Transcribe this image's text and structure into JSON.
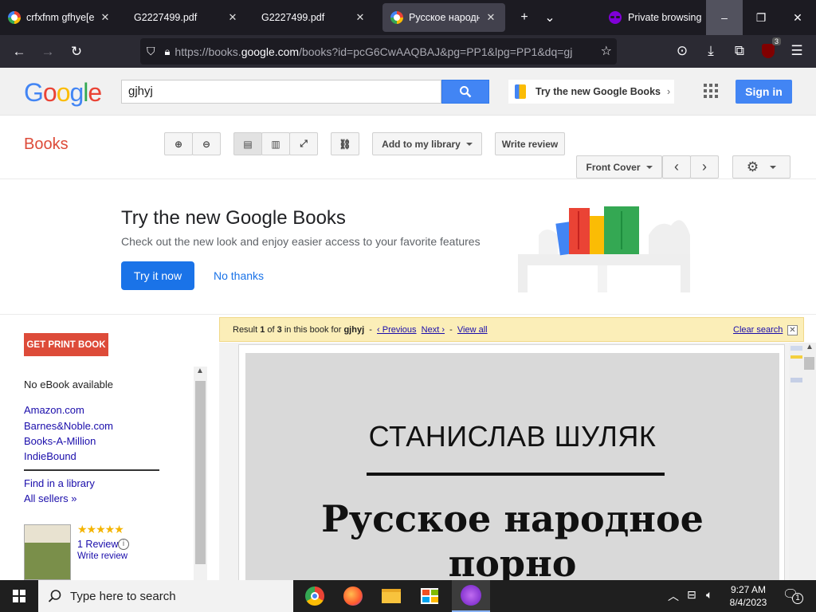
{
  "browser": {
    "tabs": [
      {
        "title": "crfxfnm gfhye[e - (",
        "active": false,
        "favicon": "google-icon"
      },
      {
        "title": "G2227499.pdf",
        "active": false,
        "favicon": "pdf-icon"
      },
      {
        "title": "G2227499.pdf",
        "active": false,
        "favicon": "pdf-icon"
      },
      {
        "title": "Русское народное",
        "active": true,
        "favicon": "google-icon"
      }
    ],
    "private_label": "Private browsing",
    "url_prefix": "https://books.",
    "url_domain": "google.com",
    "url_rest": "/books?id=pcG6CwAAQBAJ&pg=PP1&lpg=PP1&dq=gj",
    "extension_badge": "3"
  },
  "header": {
    "logo": "Google",
    "search_value": "gjhyj",
    "try_new_label": "Try the new Google Books",
    "signin_label": "Sign in"
  },
  "toolbar": {
    "books_label": "Books",
    "add_library_label": "Add to my library",
    "write_review_label": "Write review",
    "front_cover_label": "Front Cover"
  },
  "promo": {
    "title": "Try the new Google Books",
    "subtitle": "Check out the new look and enjoy easier access to your favorite features",
    "try_now": "Try it now",
    "no_thanks": "No thanks"
  },
  "sidebar": {
    "get_print": "GET PRINT BOOK",
    "no_ebook": "No eBook available",
    "sellers": [
      "Amazon.com",
      "Barnes&Noble.com",
      "Books-A-Million",
      "IndieBound"
    ],
    "find_library": "Find in a library",
    "all_sellers": "All sellers »",
    "stars": "★★★★★",
    "review_count": "1 Review",
    "write_review": "Write review"
  },
  "result_bar": {
    "prefix": "Result ",
    "current": "1",
    "of": " of ",
    "total": "3",
    "mid": " in this book for ",
    "query": "gjhyj",
    "previous": "‹ Previous",
    "next": "Next ›",
    "view_all": "View all",
    "clear": "Clear search"
  },
  "book_page": {
    "author": "СТАНИСЛАВ ШУЛЯК",
    "title_line1": "Русское народное",
    "title_line2": "порно"
  },
  "taskbar": {
    "search_placeholder": "Type here to search",
    "time": "9:27 AM",
    "date": "8/4/2023",
    "notifications": "1"
  },
  "colors": {
    "chrome_dark": "#1c1b22",
    "google_blue": "#4285f4",
    "books_red": "#dd4b39",
    "result_yellow": "#fbeeb8"
  }
}
